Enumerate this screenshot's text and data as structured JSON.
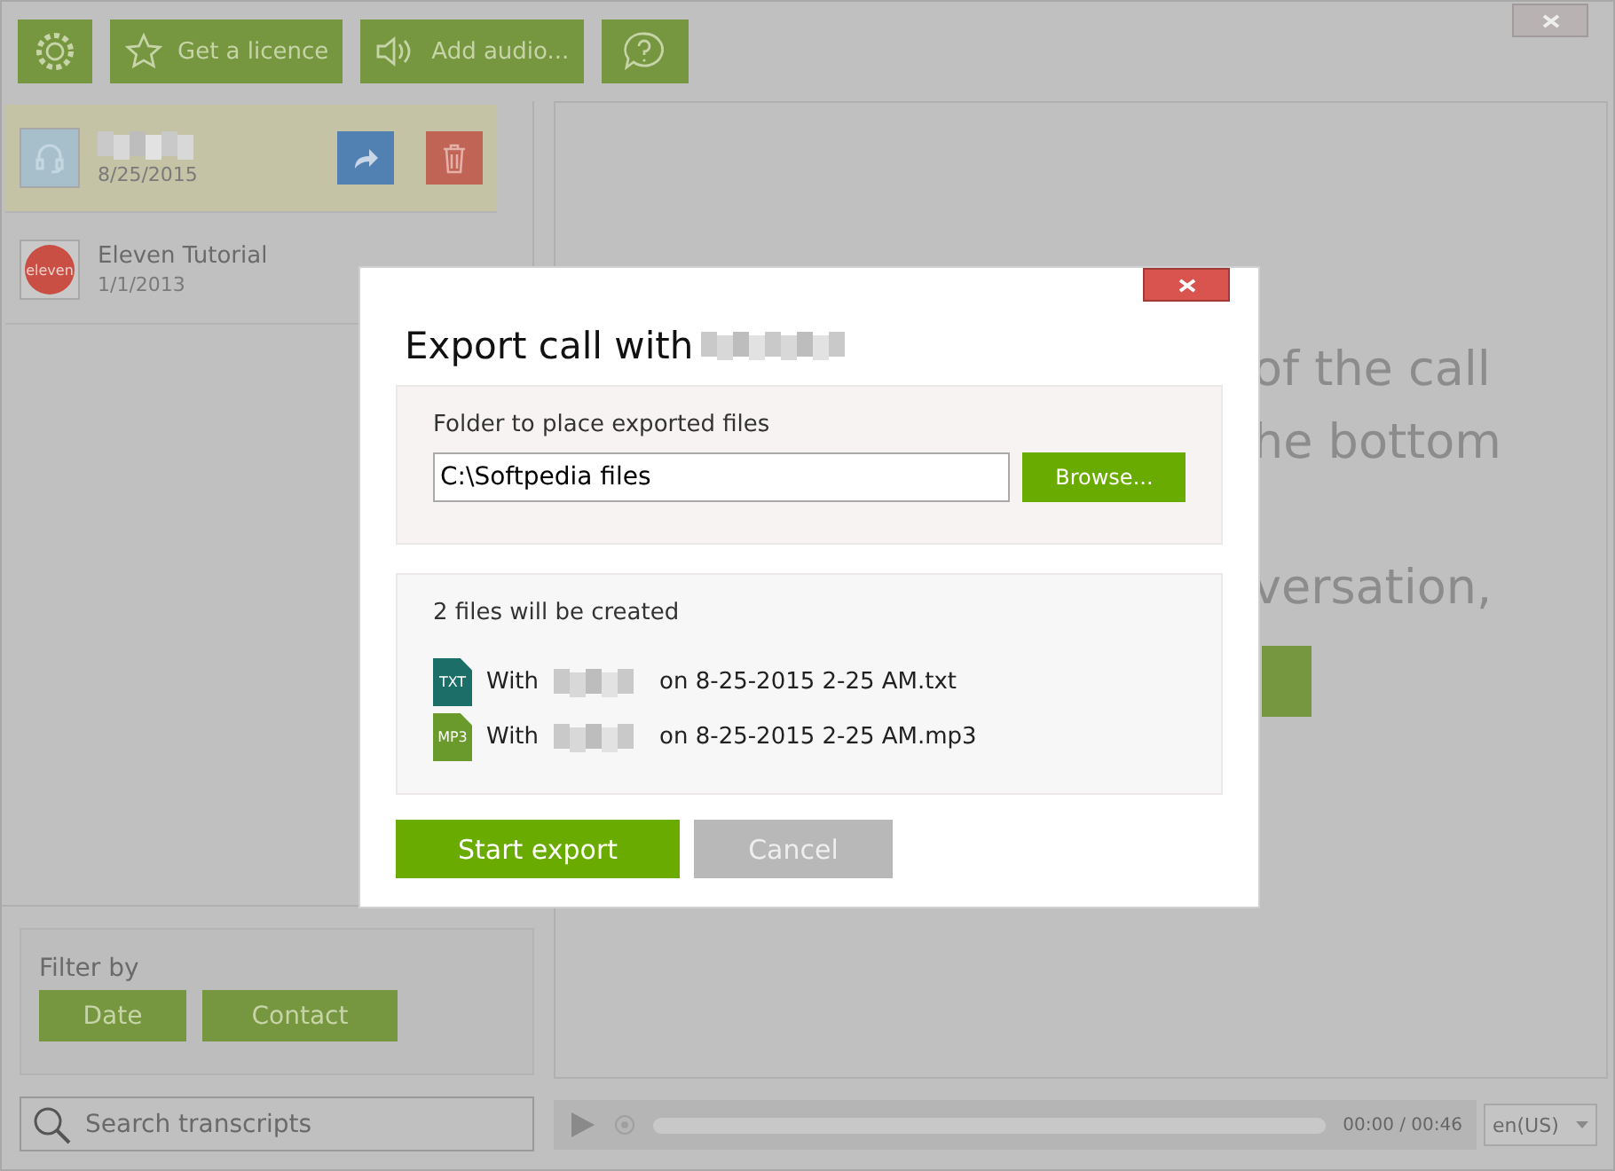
{
  "toolbar": [
    {
      "kind": "settings"
    },
    {
      "kind": "star",
      "label": "Get a licence"
    },
    {
      "kind": "audio",
      "label": "Add audio..."
    },
    {
      "kind": "help"
    }
  ],
  "calls": [
    {
      "kind": "headset",
      "date": "8/25/2015",
      "selected": true
    },
    {
      "kind": "logo",
      "logo_text": "eleven",
      "name": "Eleven Tutorial",
      "date": "1/1/2013",
      "selected": false
    }
  ],
  "filter": {
    "label": "Filter by",
    "buttons": [
      "Date",
      "Contact"
    ]
  },
  "search": {
    "placeholder": "Search transcripts"
  },
  "hint_lines": [
    "of the call",
    "he bottom",
    "versation,"
  ],
  "player": {
    "time": "00:00 / 00:46",
    "language": "en(US)"
  },
  "dialog": {
    "title": "Export call with",
    "folder_label": "Folder to place exported files",
    "folder": "C:\\Softpedia files",
    "browse": "Browse...",
    "files_label": "2 files will be created",
    "files": [
      {
        "kind": "text",
        "type": "TXT",
        "prefix": "With",
        "suffix": "on 8-25-2015 2-25 AM.txt"
      },
      {
        "kind": "audio",
        "type": "MP3",
        "prefix": "With",
        "suffix": "on 8-25-2015 2-25 AM.mp3"
      }
    ],
    "buttons": [
      {
        "kind": "primary",
        "label": "Start export"
      },
      {
        "kind": "secondary",
        "label": "Cancel"
      }
    ]
  }
}
